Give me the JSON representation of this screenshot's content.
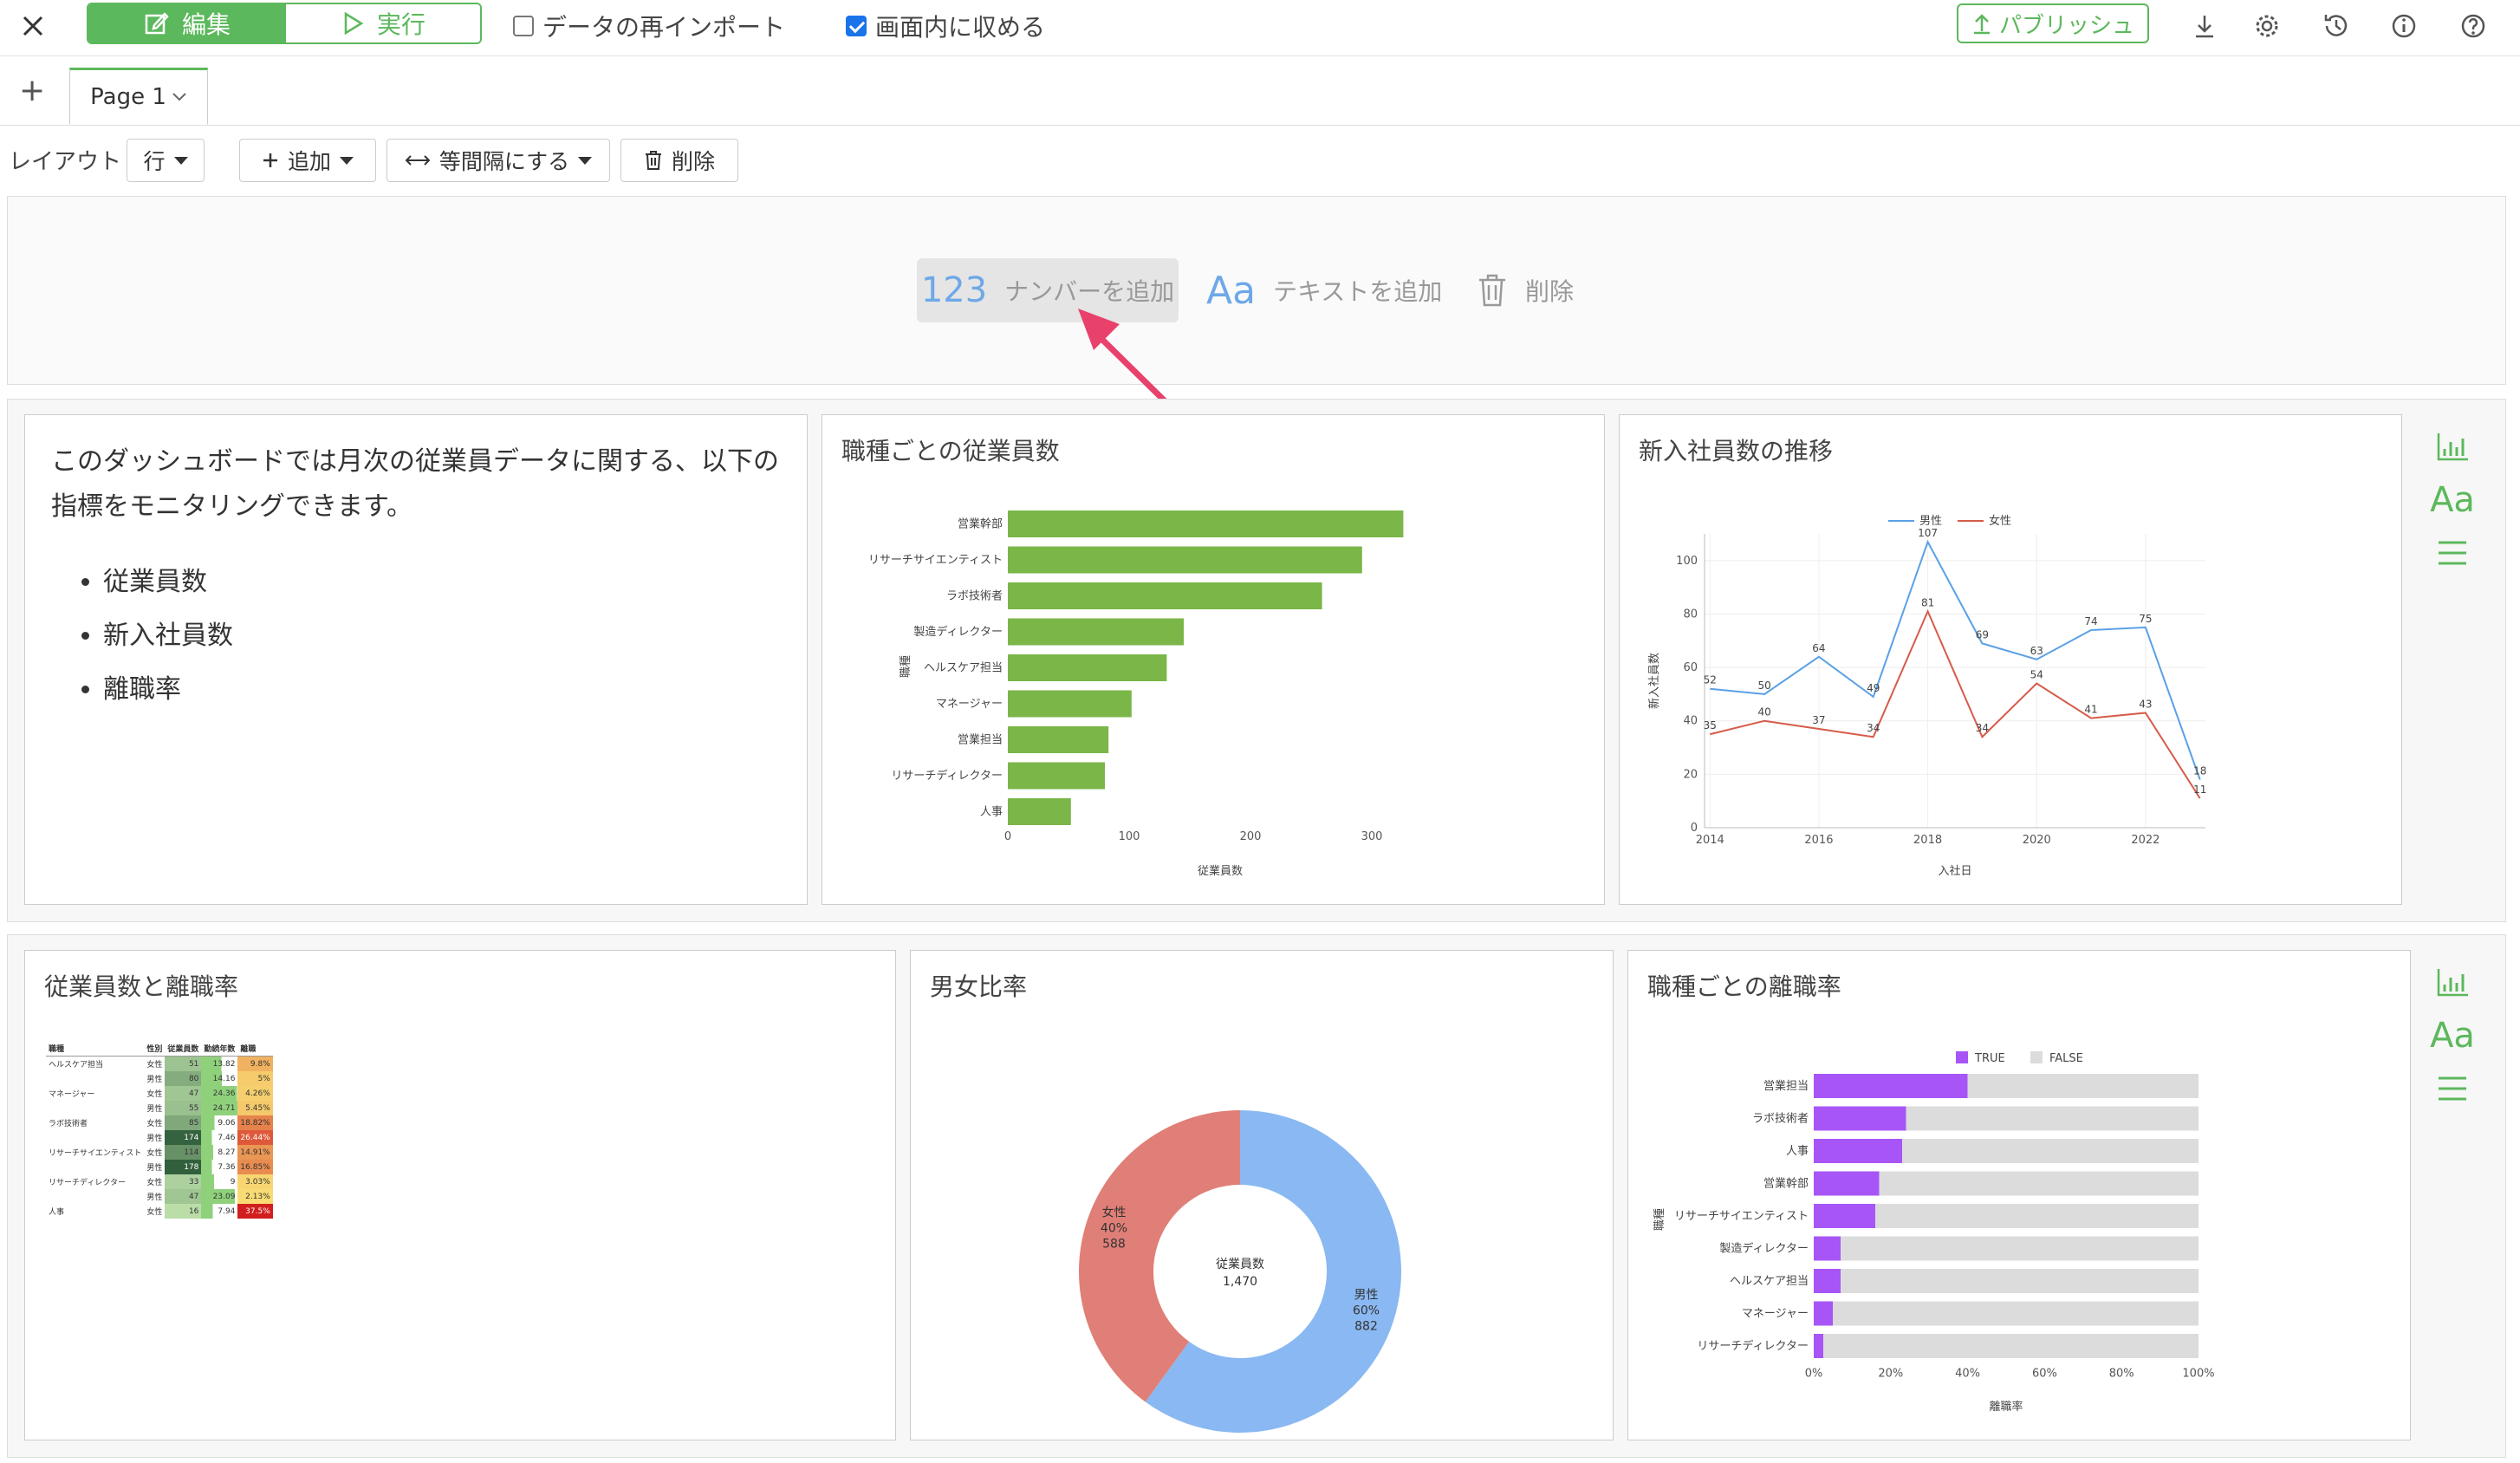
{
  "toolbar": {
    "edit_label": "編集",
    "run_label": "実行",
    "reimport_label": "データの再インポート",
    "reimport_checked": false,
    "fit_label": "画面内に収める",
    "fit_checked": true,
    "publish_label": "パブリッシュ",
    "icons": [
      "close-icon",
      "download-icon",
      "gear-icon",
      "history-icon",
      "info-icon",
      "help-icon"
    ]
  },
  "tabs": {
    "add_label": "+",
    "page_label": "Page 1"
  },
  "layout_bar": {
    "layout_label": "レイアウト",
    "row_option": "行",
    "add_label": "追加",
    "equal_label": "等間隔にする",
    "delete_label": "削除"
  },
  "add_row": {
    "number_icon": "123",
    "number_label": "ナンバーを追加",
    "text_icon": "Aa",
    "text_label": "テキストを追加",
    "delete_label": "削除",
    "arrow_color": "#e8416c"
  },
  "text_card": {
    "line1": "このダッシュボードでは月次の従業員データに関する、以下の",
    "line2": "指標をモニタリングできます。",
    "items": [
      "従業員数",
      "新入社員数",
      "離職率"
    ]
  },
  "side_icons": [
    "bar-chart-icon",
    "text-icon",
    "menu-icon"
  ],
  "side_text": "Aa",
  "charts": [
    {
      "id": "bar-jobs",
      "title": "職種ごとの従業員数",
      "chart_data": {
        "type": "bar",
        "orientation": "horizontal",
        "categories": [
          "営業幹部",
          "リサーチサイエンティスト",
          "ラボ技術者",
          "製造ディレクター",
          "ヘルスケア担当",
          "マネージャー",
          "営業担当",
          "リサーチディレクター",
          "人事"
        ],
        "values": [
          326,
          292,
          259,
          145,
          131,
          102,
          83,
          80,
          52
        ],
        "xlabel": "従業員数",
        "ylabel": "職種",
        "xticks": [
          "0",
          "100",
          "200",
          "300"
        ],
        "xlim": [
          0,
          350
        ],
        "color": "#7ab648"
      }
    },
    {
      "id": "line-hires",
      "title": "新入社員数の推移",
      "chart_data": {
        "type": "line",
        "x": [
          2014,
          2015,
          2016,
          2017,
          2018,
          2019,
          2020,
          2021,
          2022,
          2023
        ],
        "xticks": [
          "2014",
          "2016",
          "2018",
          "2020",
          "2022"
        ],
        "yticks": [
          "0",
          "20",
          "40",
          "60",
          "80",
          "100"
        ],
        "ylim": [
          0,
          110
        ],
        "xlabel": "入社日",
        "ylabel": "新入社員数",
        "legend_position": "top",
        "series": [
          {
            "name": "男性",
            "color": "#5aa0e6",
            "values": [
              52,
              50,
              64,
              49,
              107,
              69,
              63,
              74,
              75,
              18
            ]
          },
          {
            "name": "女性",
            "color": "#d65b4a",
            "values": [
              35,
              40,
              37,
              34,
              81,
              34,
              54,
              41,
              43,
              11
            ]
          }
        ]
      }
    },
    {
      "id": "table-attrition",
      "title": "従業員数と離職率",
      "chart_data": {
        "type": "table",
        "headers": [
          "職種",
          "性別",
          "従業員数",
          "勤続年数",
          "離職"
        ],
        "rows": [
          [
            "ヘルスケア担当",
            "女性",
            "51",
            "13.82",
            "9.8%"
          ],
          [
            "",
            "男性",
            "80",
            "14.16",
            "5%"
          ],
          [
            "マネージャー",
            "女性",
            "47",
            "24.36",
            "4.26%"
          ],
          [
            "",
            "男性",
            "55",
            "24.71",
            "5.45%"
          ],
          [
            "ラボ技術者",
            "女性",
            "85",
            "9.06",
            "18.82%"
          ],
          [
            "",
            "男性",
            "174",
            "7.46",
            "26.44%"
          ],
          [
            "リサーチサイエンティスト",
            "女性",
            "114",
            "8.27",
            "14.91%"
          ],
          [
            "",
            "男性",
            "178",
            "7.36",
            "16.85%"
          ],
          [
            "リサーチディレクター",
            "女性",
            "33",
            "9",
            "3.03%"
          ],
          [
            "",
            "男性",
            "47",
            "23.09",
            "2.13%"
          ],
          [
            "人事",
            "女性",
            "16",
            "7.94",
            "37.5%"
          ]
        ]
      }
    },
    {
      "id": "donut-gender",
      "title": "男女比率",
      "chart_data": {
        "type": "pie",
        "center_label": "従業員数",
        "center_value": "1,470",
        "slices": [
          {
            "name": "男性",
            "pct": "60%",
            "value": 882,
            "color": "#8ab8f2"
          },
          {
            "name": "女性",
            "pct": "40%",
            "value": 588,
            "color": "#e07f77"
          }
        ]
      }
    },
    {
      "id": "stack-attrition",
      "title": "職種ごとの離職率",
      "chart_data": {
        "type": "bar",
        "orientation": "horizontal",
        "stacked": true,
        "categories": [
          "営業担当",
          "ラボ技術者",
          "人事",
          "営業幹部",
          "リサーチサイエンティスト",
          "製造ディレクター",
          "ヘルスケア担当",
          "マネージャー",
          "リサーチディレクター"
        ],
        "series": [
          {
            "name": "TRUE",
            "color": "#a855f7",
            "values": [
              0.4,
              0.24,
              0.23,
              0.17,
              0.16,
              0.07,
              0.07,
              0.05,
              0.025
            ]
          },
          {
            "name": "FALSE",
            "color": "#dcdcdc",
            "values": [
              0.6,
              0.76,
              0.77,
              0.83,
              0.84,
              0.93,
              0.93,
              0.95,
              0.975
            ]
          }
        ],
        "xticks": [
          "0%",
          "20%",
          "40%",
          "60%",
          "80%",
          "100%"
        ],
        "xlabel": "離職率",
        "ylabel": "職種",
        "legend_position": "top"
      }
    }
  ]
}
